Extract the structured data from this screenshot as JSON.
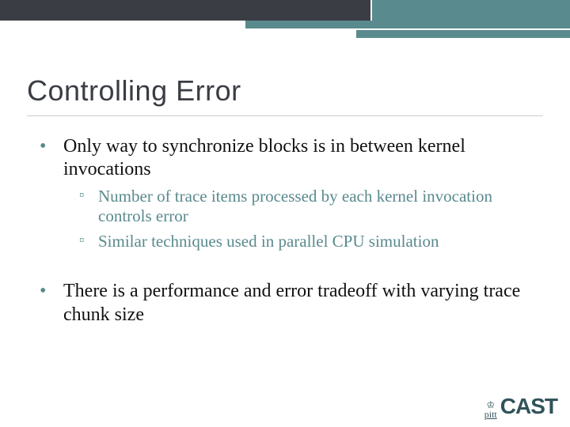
{
  "title": "Controlling Error",
  "bullets": {
    "b1": "Only way to synchronize blocks is in between kernel invocations",
    "b1_sub": {
      "s1": "Number of trace items processed by each kernel invocation controls error",
      "s2": "Similar techniques used in parallel CPU simulation"
    },
    "b2": "There is a performance and error tradeoff with varying trace chunk size"
  },
  "logo": {
    "pitt": "pitt",
    "cast": "CAST"
  }
}
